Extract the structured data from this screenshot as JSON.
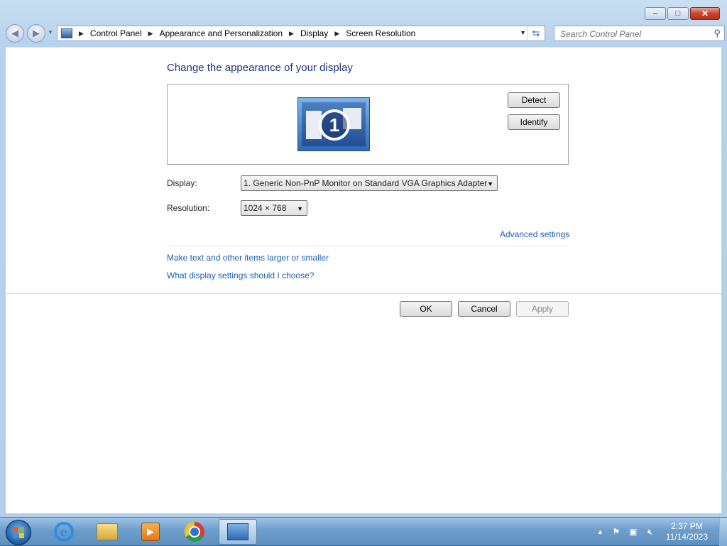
{
  "window": {
    "caption_buttons": {
      "minimize": "–",
      "maximize": "□",
      "close": "✕"
    }
  },
  "navigation": {
    "back_icon": "back-arrow-icon",
    "forward_icon": "forward-arrow-icon",
    "breadcrumb": [
      "Control Panel",
      "Appearance and Personalization",
      "Display",
      "Screen Resolution"
    ],
    "search_placeholder": "Search Control Panel"
  },
  "main": {
    "heading": "Change the appearance of your display",
    "monitor_number": "1",
    "detect_label": "Detect",
    "identify_label": "Identify",
    "display_label": "Display:",
    "display_value": "1. Generic Non-PnP Monitor on Standard VGA Graphics Adapter",
    "resolution_label": "Resolution:",
    "resolution_value": "1024 × 768",
    "advanced_link": "Advanced settings",
    "link_text_size": "Make text and other items larger or smaller",
    "link_display_help": "What display settings should I choose?",
    "ok_label": "OK",
    "cancel_label": "Cancel",
    "apply_label": "Apply"
  },
  "taskbar": {
    "pinned": [
      "Internet Explorer",
      "Windows Explorer",
      "Windows Media Player",
      "Google Chrome",
      "Screen Resolution"
    ],
    "clock_time": "2:37 PM",
    "clock_date": "11/14/2023"
  },
  "colors": {
    "heading": "#1e3287",
    "link": "#1a5fb4",
    "taskbar": "#6d9ecc"
  }
}
